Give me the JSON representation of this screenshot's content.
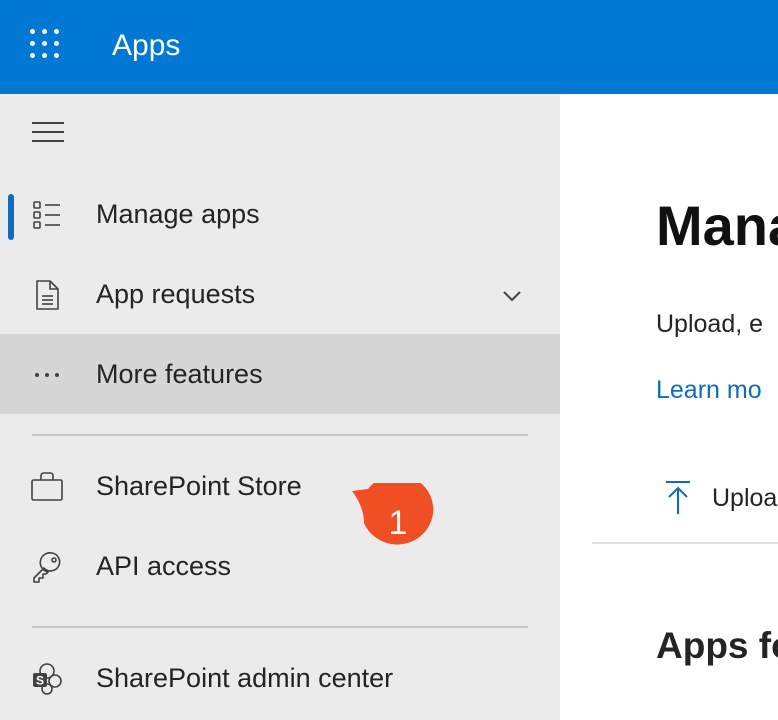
{
  "header": {
    "app_title": "Apps",
    "waffle_icon": "app-launcher-icon",
    "background_color": "#0078d4"
  },
  "sidebar": {
    "menu_icon": "hamburger-icon",
    "items": [
      {
        "label": "Manage apps",
        "icon": "list-icon",
        "active": true
      },
      {
        "label": "App requests",
        "icon": "document-icon",
        "expandable": true
      },
      {
        "label": "More features",
        "icon": "more-icon",
        "highlighted": true
      },
      {
        "label": "SharePoint Store",
        "icon": "shopping-bag-icon"
      },
      {
        "label": "API access",
        "icon": "key-icon"
      },
      {
        "label": "SharePoint admin center",
        "icon": "sharepoint-icon"
      }
    ],
    "accent_color": "#0f6cbd"
  },
  "callout": {
    "number": "1",
    "color": "#f04e23"
  },
  "main": {
    "title": "Mana",
    "description": "Upload, e",
    "learn_more": "Learn mo",
    "upload_label": "Uploa",
    "section_heading": "Apps fo"
  }
}
